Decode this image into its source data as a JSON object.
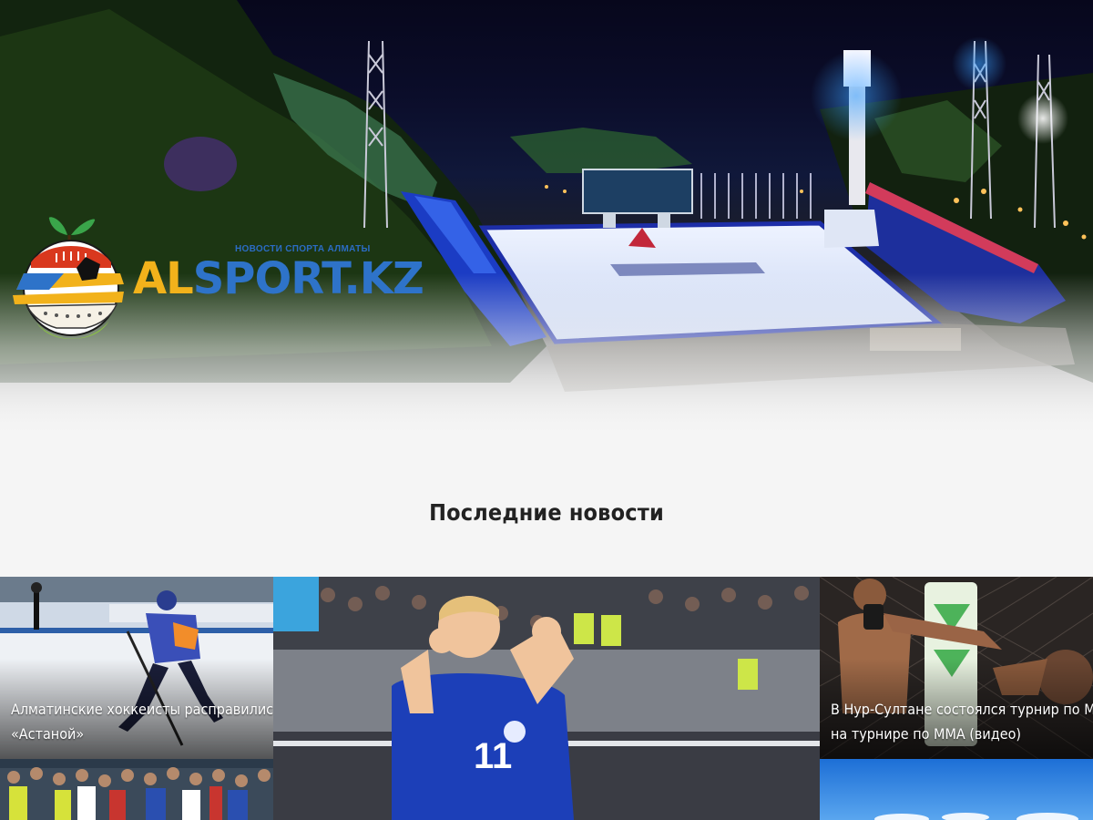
{
  "site": {
    "logo": {
      "tagline": "НОВОСТИ СПОРТА АЛМАТЫ",
      "name_part1": "AL",
      "name_part2": "SPORT.KZ",
      "colors": {
        "yellow": "#f2b21b",
        "blue": "#2e73c9",
        "green": "#8cc63f",
        "red": "#d9381e"
      }
    },
    "hero": {
      "description": "Stadium illuminated at night"
    }
  },
  "news": {
    "section_title": "Последние новости",
    "items": [
      {
        "caption_line1": "Алматинские хоккеисты расправились с",
        "caption_line2": "«Астаной»"
      },
      {
        "caption_line1": "",
        "caption_line2": ""
      },
      {
        "caption_line1": "В Нур-Султане состоялся турнир по ММА",
        "caption_line2": "на турнире по ММА (видео)"
      },
      {
        "caption_line1": "",
        "caption_line2": ""
      },
      {
        "caption_line1": "",
        "caption_line2": ""
      }
    ]
  },
  "colors": {
    "page_bg": "#f5f5f5",
    "title_text": "#222222"
  }
}
